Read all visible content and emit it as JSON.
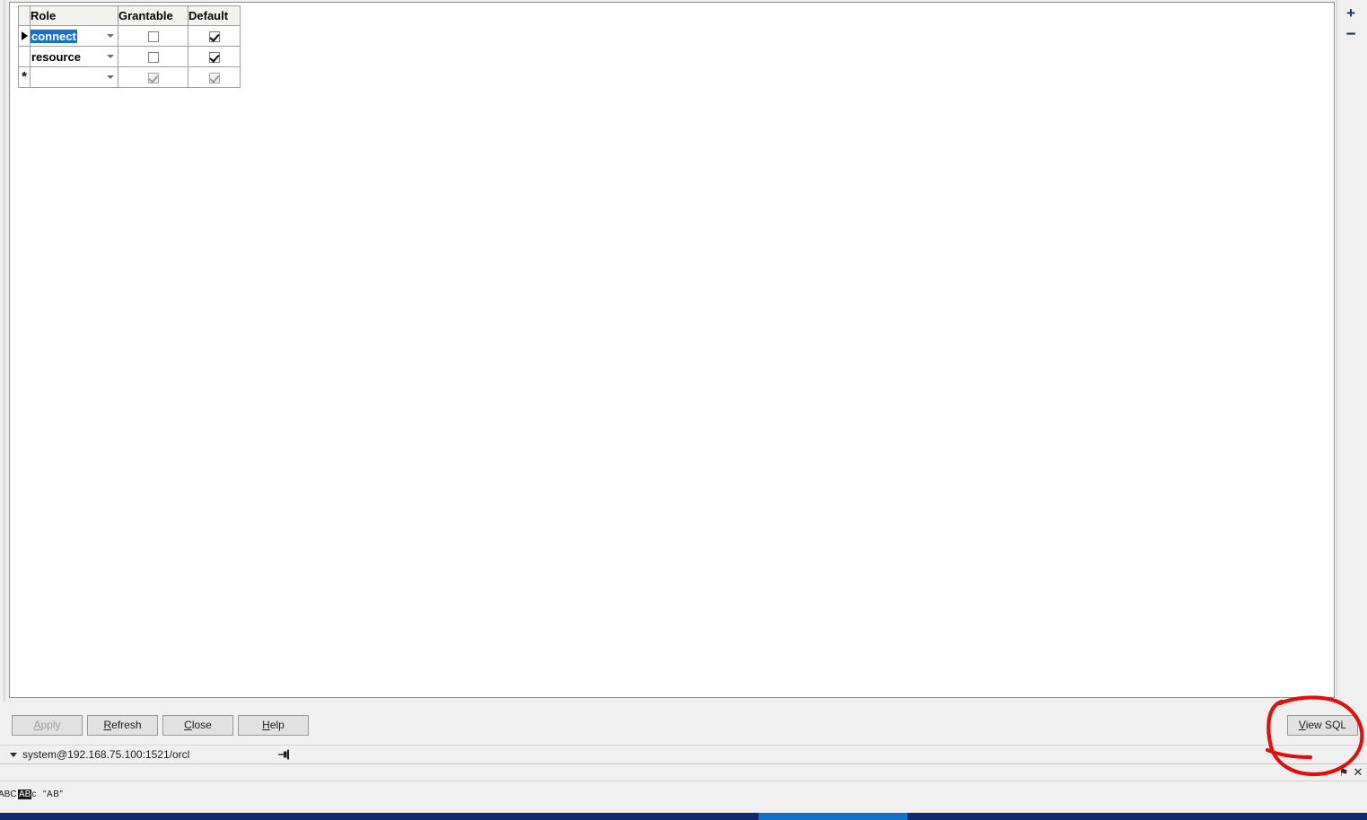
{
  "window": {
    "kind": "oracle-user-roles-grid"
  },
  "grid": {
    "name": "roles-grid",
    "columns": [
      "Role",
      "Grantable",
      "Default"
    ],
    "rows": [
      {
        "selector": "current-row-arrow",
        "role": "connect",
        "role_selected": true,
        "grantable": false,
        "default": true,
        "is_new_row": false
      },
      {
        "selector": "blank",
        "role": "resource",
        "role_selected": false,
        "grantable": false,
        "default": true,
        "is_new_row": false
      },
      {
        "selector": "new-row-asterisk",
        "role": "",
        "role_selected": false,
        "grantable": true,
        "default": true,
        "is_new_row": true
      }
    ],
    "new_row_marker": "*"
  },
  "rail": {
    "zoom_in_label": "+",
    "zoom_out_label": "−",
    "zoom_in_icon": "plus-icon",
    "zoom_out_icon": "minus-icon",
    "accent_color": "#1c2a66"
  },
  "buttons": {
    "apply": {
      "label_pre": "",
      "mnemonic": "A",
      "label_post": "pply",
      "enabled": false
    },
    "refresh": {
      "label_pre": "",
      "mnemonic": "R",
      "label_post": "efresh",
      "enabled": true
    },
    "close": {
      "label_pre": "",
      "mnemonic": "C",
      "label_post": "lose",
      "enabled": true
    },
    "help": {
      "label_pre": "",
      "mnemonic": "H",
      "label_post": "elp",
      "enabled": true
    },
    "view_sql": {
      "label_pre": "",
      "mnemonic": "V",
      "label_post": "iew SQL",
      "enabled": true
    }
  },
  "connection": {
    "text": "system@192.168.75.100:1521/orcl",
    "caret_icon": "chevron-down-icon",
    "pin_icon": "pushpin-icon"
  },
  "panel_bar": {
    "pin_icon": "pushpin-icon",
    "close_icon": "close-icon",
    "close_glyph": "✕",
    "pin_glyph": "⚑"
  },
  "icon_strip": {
    "items": [
      {
        "name": "spellcheck-abc-icon",
        "label": "ABC"
      },
      {
        "name": "abc-inverted-icon",
        "label": "AB",
        "suffix": "c"
      },
      {
        "name": "quoted-ab-icon",
        "label": "\"AB\""
      }
    ]
  },
  "taskbar": {
    "background": "#11296b",
    "active_item_color": "#1171c4"
  },
  "annotation": {
    "kind": "hand-drawn-red-circle",
    "target": "view-sql-button",
    "color": "#e11010"
  }
}
